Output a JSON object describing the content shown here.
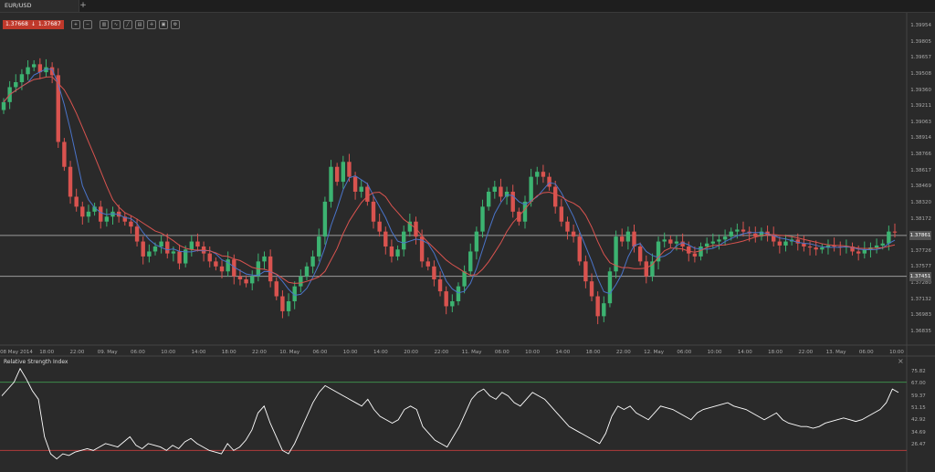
{
  "tabs": {
    "active": "EUR/USD",
    "add": "+"
  },
  "quote": {
    "bid": "1.37668",
    "direction": "↓",
    "ask": "1.37687"
  },
  "toolbar_icons": [
    "zoom-in-icon",
    "zoom-out-icon",
    "chart-type-icon",
    "indicators-icon",
    "draw-icon",
    "template-icon",
    "crosshair-icon",
    "save-icon",
    "settings-icon"
  ],
  "colors": {
    "up": "#3cb371",
    "down": "#d9534f",
    "ma_fast": "#4a74c9",
    "ma_slow": "#d9534f",
    "rsi_line": "#ffffff",
    "rsi_upper": "#3d8a4a",
    "rsi_lower": "#b03a3a",
    "hline": "#9a9a9a"
  },
  "y_axis": [
    "1.39954",
    "1.39805",
    "1.39657",
    "1.39508",
    "1.39360",
    "1.39211",
    "1.39063",
    "1.38914",
    "1.38766",
    "1.38617",
    "1.38469",
    "1.38320",
    "1.38172",
    "1.38023",
    "1.37726",
    "1.37577",
    "1.37280",
    "1.37132",
    "1.36983",
    "1.36835"
  ],
  "highlighted_levels": [
    "1.37861",
    "1.37451"
  ],
  "x_axis": [
    "08 May 2014",
    "18:00",
    "22:00",
    "09. May",
    "06:00",
    "10:00",
    "14:00",
    "18:00",
    "22:00",
    "10. May",
    "06:00",
    "10:00",
    "14:00",
    "20:00",
    "22:00",
    "11. May",
    "06:00",
    "10:00",
    "14:00",
    "18:00",
    "22:00",
    "12. May",
    "06:00",
    "10:00",
    "14:00",
    "18:00",
    "22:00",
    "13. May",
    "06:00",
    "10:00"
  ],
  "rsi": {
    "title": "Relative Strength Index",
    "close": "×",
    "axis": [
      "75.82",
      "67.00",
      "59.37",
      "51.15",
      "42.92",
      "34.69",
      "26.47"
    ],
    "upper_level": 70,
    "lower_level": 30
  },
  "chart_data": {
    "type": "candlestick",
    "symbol": "EUR/USD",
    "levels": [
      1.37861,
      1.37451
    ],
    "ylim": [
      1.3676,
      1.4006
    ],
    "close": [
      1.392,
      1.3935,
      1.394,
      1.3948,
      1.3955,
      1.3958,
      1.395,
      1.3955,
      1.3947,
      1.388,
      1.3855,
      1.3825,
      1.3815,
      1.3805,
      1.381,
      1.3815,
      1.38,
      1.3805,
      1.381,
      1.3805,
      1.38,
      1.3795,
      1.378,
      1.3765,
      1.377,
      1.3775,
      1.378,
      1.3768,
      1.377,
      1.3758,
      1.3772,
      1.378,
      1.3775,
      1.3768,
      1.376,
      1.3755,
      1.375,
      1.3762,
      1.3745,
      1.3742,
      1.3738,
      1.3745,
      1.376,
      1.3765,
      1.374,
      1.3725,
      1.371,
      1.372,
      1.3735,
      1.3745,
      1.3755,
      1.3765,
      1.3785,
      1.382,
      1.3855,
      1.384,
      1.386,
      1.3845,
      1.383,
      1.3835,
      1.382,
      1.38,
      1.379,
      1.3775,
      1.3765,
      1.3772,
      1.379,
      1.38,
      1.3785,
      1.376,
      1.3755,
      1.3742,
      1.373,
      1.3715,
      1.372,
      1.3735,
      1.375,
      1.377,
      1.379,
      1.3815,
      1.383,
      1.3835,
      1.3825,
      1.383,
      1.381,
      1.38,
      1.382,
      1.3845,
      1.385,
      1.3845,
      1.3835,
      1.3815,
      1.38,
      1.379,
      1.3785,
      1.376,
      1.374,
      1.3725,
      1.3705,
      1.3718,
      1.375,
      1.3785,
      1.378,
      1.379,
      1.3775,
      1.376,
      1.3745,
      1.376,
      1.378,
      1.3782,
      1.3778,
      1.378,
      1.3775,
      1.3768,
      1.3765,
      1.3775,
      1.3778,
      1.378,
      1.3782,
      1.3785,
      1.379,
      1.3792,
      1.379,
      1.3788,
      1.3785,
      1.379,
      1.3787,
      1.378,
      1.3776,
      1.378,
      1.3782,
      1.3778,
      1.3775,
      1.3774,
      1.3772,
      1.3774,
      1.3776,
      1.3775,
      1.3774,
      1.3775,
      1.377,
      1.3768,
      1.3772,
      1.3774,
      1.3776,
      1.3778,
      1.379,
      1.3789
    ],
    "rsi_values": [
      62,
      66,
      70,
      78,
      72,
      65,
      60,
      38,
      28,
      25,
      28,
      27,
      29,
      30,
      31,
      30,
      32,
      34,
      33,
      32,
      35,
      38,
      33,
      31,
      34,
      33,
      32,
      30,
      33,
      31,
      35,
      37,
      34,
      32,
      30,
      29,
      28,
      34,
      30,
      32,
      36,
      42,
      52,
      56,
      46,
      38,
      30,
      28,
      34,
      42,
      50,
      58,
      64,
      68,
      66,
      64,
      62,
      60,
      58,
      56,
      60,
      54,
      50,
      48,
      46,
      48,
      54,
      56,
      54,
      44,
      40,
      36,
      34,
      32,
      38,
      44,
      52,
      60,
      64,
      66,
      62,
      60,
      64,
      62,
      58,
      56,
      60,
      64,
      62,
      60,
      56,
      52,
      48,
      44,
      42,
      40,
      38,
      36,
      34,
      40,
      50,
      56,
      54,
      56,
      52,
      50,
      48,
      52,
      56,
      55,
      54,
      52,
      50,
      48,
      52,
      54,
      55,
      56,
      57,
      58,
      56,
      55,
      54,
      52,
      50,
      48,
      50,
      52,
      48,
      46,
      45,
      44,
      44,
      43,
      44,
      46,
      47,
      48,
      49,
      48,
      47,
      48,
      50,
      52,
      54,
      58,
      66,
      64
    ],
    "rsi_ylim": [
      20,
      80
    ]
  }
}
